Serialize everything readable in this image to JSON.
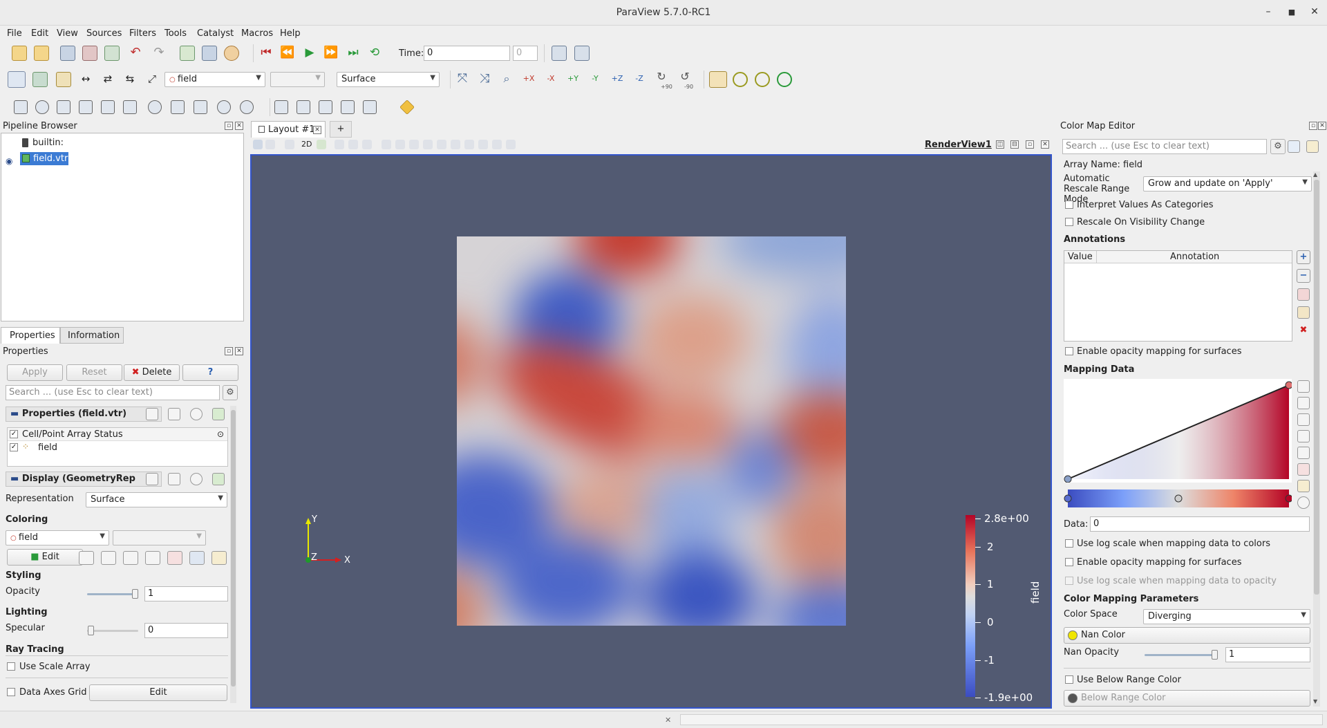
{
  "window": {
    "title": "ParaView 5.7.0-RC1"
  },
  "menu": [
    "File",
    "Edit",
    "View",
    "Sources",
    "Filters",
    "Tools",
    "Catalyst",
    "Macros",
    "Help"
  ],
  "toolbar": {
    "time_label": "Time:",
    "time_value": "0",
    "timestep_value": "0",
    "color_array": "field",
    "color_component": "",
    "representation": "Surface",
    "rotate_plus_label": "+90",
    "rotate_minus_label": "-90"
  },
  "pipeline": {
    "title": "Pipeline Browser",
    "items": [
      {
        "label": "builtin:"
      },
      {
        "label": "field.vtr"
      }
    ]
  },
  "props": {
    "tabs": [
      "Properties",
      "Information"
    ],
    "title": "Properties",
    "apply": "Apply",
    "reset": "Reset",
    "delete": "Delete",
    "help": "?",
    "search_placeholder": "Search ... (use Esc to clear text)",
    "section_properties": "Properties (field.vtr)",
    "array_status_header": "Cell/Point Array Status",
    "array_name": "field",
    "section_display": "Display (GeometryRep",
    "representation_label": "Representation",
    "representation_value": "Surface",
    "coloring_label": "Coloring",
    "coloring_array": "field",
    "edit_label": "Edit",
    "styling_label": "Styling",
    "opacity_label": "Opacity",
    "opacity_value": "1",
    "lighting_label": "Lighting",
    "specular_label": "Specular",
    "specular_value": "0",
    "raytracing_label": "Ray Tracing",
    "use_scale_array": "Use Scale Array",
    "data_axes_grid": "Data Axes Grid",
    "data_axes_edit": "Edit"
  },
  "view": {
    "tab_label": "Layout #1",
    "add_tab": "+",
    "mode_2d": "2D",
    "view_name": "RenderView1",
    "background": "#525a72",
    "colorbar": {
      "title": "field",
      "ticks": [
        "2.8e+00",
        "2",
        "1",
        "0",
        "-1",
        "-1.9e+00"
      ]
    },
    "axes": {
      "y": "Y",
      "z": "Z",
      "x": "X"
    }
  },
  "cme": {
    "title": "Color Map Editor",
    "search_placeholder": "Search ... (use Esc to clear text)",
    "array_name": "Array Name: field",
    "auto_rescale_label": "Automatic Rescale Range Mode",
    "auto_rescale_value": "Grow and update on 'Apply'",
    "interpret_categories": "Interpret Values As Categories",
    "rescale_visibility": "Rescale On Visibility Change",
    "annotations_label": "Annotations",
    "col_value": "Value",
    "col_annotation": "Annotation",
    "enable_opacity_surfaces": "Enable opacity mapping for surfaces",
    "mapping_data_label": "Mapping Data",
    "data_label": "Data:",
    "data_value": "0",
    "log_scale_colors": "Use log scale when mapping data to colors",
    "enable_opacity_surfaces2": "Enable opacity mapping for surfaces",
    "log_scale_opacity": "Use log scale when mapping data to opacity",
    "color_mapping_params": "Color Mapping Parameters",
    "color_space_label": "Color Space",
    "color_space_value": "Diverging",
    "nan_color": "Nan Color",
    "nan_color_hex": "#f0e600",
    "nan_opacity_label": "Nan Opacity",
    "nan_opacity_value": "1",
    "below_range_check": "Use Below Range Color",
    "below_range_color": "Below Range Color"
  },
  "colors": {
    "accent": "#3b7bd4",
    "cold": "#3b4cc0",
    "neutral": "#dddddd",
    "warm": "#b40426"
  }
}
